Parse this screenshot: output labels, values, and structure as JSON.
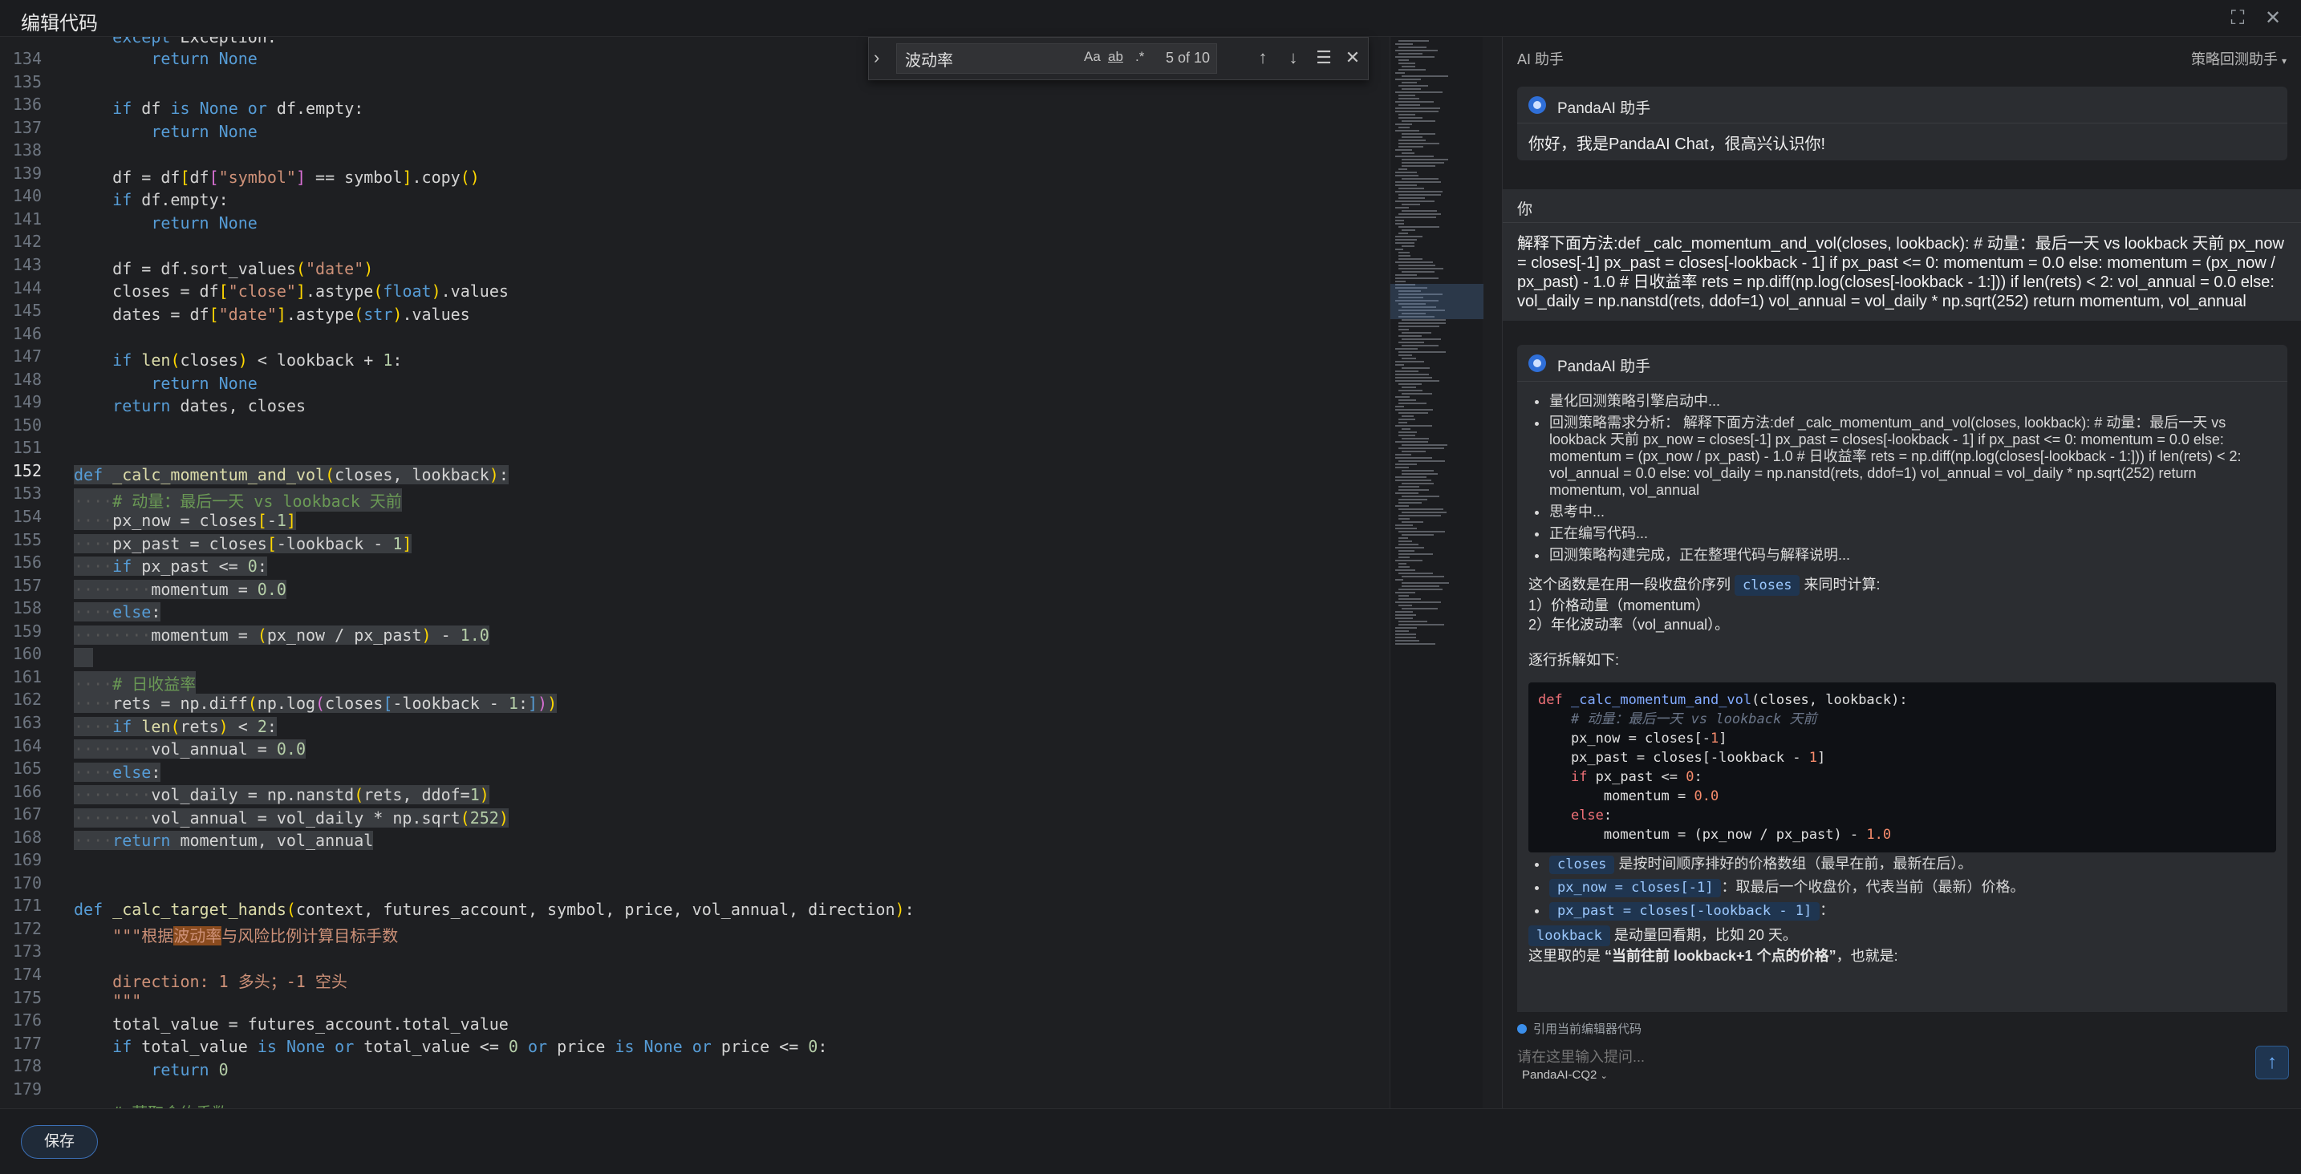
{
  "window": {
    "title": "编辑代码"
  },
  "find": {
    "query": "波动率",
    "opt_case": "Aa",
    "opt_word": "ab",
    "opt_regex": ".*",
    "count": "5 of 10"
  },
  "editor": {
    "line_numbers": [
      "134",
      "135",
      "136",
      "137",
      "138",
      "139",
      "140",
      "141",
      "142",
      "143",
      "144",
      "145",
      "146",
      "147",
      "148",
      "149",
      "150",
      "151",
      "152",
      "153",
      "154",
      "155",
      "156",
      "157",
      "158",
      "159",
      "160",
      "161",
      "162",
      "163",
      "164",
      "165",
      "166",
      "167",
      "168",
      "169",
      "170",
      "171",
      "172",
      "173",
      "174",
      "175",
      "176",
      "177",
      "178",
      "179"
    ],
    "active_line": "152"
  },
  "panel": {
    "title": "AI 助手",
    "mode": "策略回测助手",
    "assistant_name": "PandaAI 助手",
    "greeting": "你好，我是PandaAI Chat，很高兴认识你!",
    "user_label": "你",
    "user_message": "解释下面方法:def _calc_momentum_and_vol(closes, lookback): # 动量：最后一天 vs lookback 天前 px_now = closes[-1] px_past = closes[-lookback - 1] if px_past <= 0: momentum = 0.0 else: momentum = (px_now / px_past) - 1.0 # 日收益率 rets = np.diff(np.log(closes[-lookback - 1:])) if len(rets) < 2: vol_annual = 0.0 else: vol_daily = np.nanstd(rets, ddof=1) vol_annual = vol_daily * np.sqrt(252) return momentum, vol_annual",
    "steps": [
      "量化回测策略引擎启动中...",
      "回测策略需求分析： 解释下面方法:def _calc_momentum_and_vol(closes, lookback): # 动量：最后一天 vs lookback 天前 px_now = closes[-1] px_past = closes[-lookback - 1] if px_past <= 0: momentum = 0.0 else: momentum = (px_now / px_past) - 1.0 # 日收益率 rets = np.diff(np.log(closes[-lookback - 1:])) if len(rets) < 2: vol_annual = 0.0 else: vol_daily = np.nanstd(rets, ddof=1) vol_annual = vol_daily * np.sqrt(252) return momentum, vol_annual",
      "思考中...",
      "正在编写代码...",
      "回测策略构建完成，正在整理代码与解释说明..."
    ],
    "intro_pre": "这个函数是在用一段收盘价序列",
    "intro_pill": "closes",
    "intro_post": "来同时计算:",
    "point1": "1）价格动量（momentum）",
    "point2": "2）年化波动率（vol_annual）。",
    "breakdown": "逐行拆解如下:",
    "exp1_pill": "closes",
    "exp1_text": "是按时间顺序排好的价格数组（最早在前，最新在后）。",
    "exp2_pill": "px_now = closes[-1]",
    "exp2_text": "：取最后一个收盘价，代表当前（最新）价格。",
    "exp3_pill": "px_past = closes[-lookback - 1]",
    "exp3_text": "：",
    "exp4_pill": "lookback",
    "exp4_text": "是动量回看期，比如 20 天。",
    "exp5_pre": "这里取的是",
    "exp5_bold": "“当前往前 lookback+1 个点的价格”",
    "exp5_post": "，也就是:",
    "cite": "引用当前编辑器代码",
    "input_placeholder": "请在这里输入提问...",
    "model": "PandaAI-CQ2"
  },
  "footer": {
    "save": "保存"
  }
}
